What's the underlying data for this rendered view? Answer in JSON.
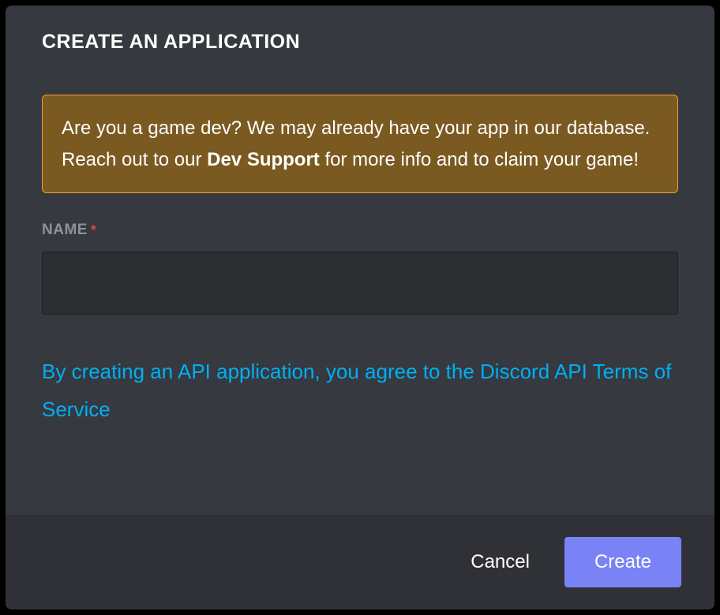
{
  "modal": {
    "title": "Create an Application",
    "notice": {
      "text_before": "Are you a game dev? We may already have your app in our database. Reach out to our ",
      "bold_text": "Dev Support",
      "text_after": " for more info and to claim your game!"
    },
    "name_field": {
      "label": "Name",
      "required_mark": "*",
      "value": ""
    },
    "terms_text": "By creating an API application, you agree to the Discord API Terms of Service",
    "footer": {
      "cancel_label": "Cancel",
      "create_label": "Create"
    }
  }
}
